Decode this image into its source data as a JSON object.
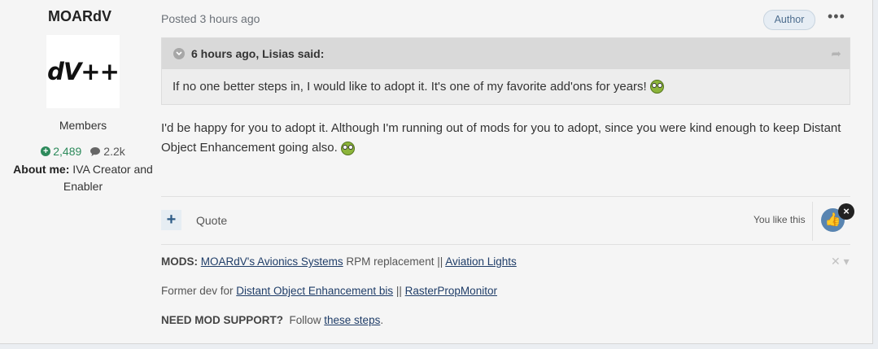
{
  "author": {
    "name": "MOARdV",
    "avatar_text": "dV++",
    "group": "Members",
    "reputation": "2,489",
    "posts": "2.2k",
    "about_label": "About me:",
    "about_value": "IVA Creator and Enabler"
  },
  "post": {
    "posted": "Posted 3 hours ago",
    "badge": "Author",
    "more": "•••",
    "quote_header": "6 hours ago, Lisias said:",
    "quote_text": "If no one better steps in, I would like to adopt it. It's one of my favorite add'ons for years!",
    "content": "I'd be happy for you to adopt it.  Although I'm running out of mods for you to adopt, since you were kind enough to keep Distant Object Enhancement going also."
  },
  "actions": {
    "plus": "+",
    "quote": "Quote",
    "you_like": "You like this",
    "like_icon": "👍",
    "remove_like": "×"
  },
  "signature": {
    "mods_label": "MODS:",
    "mod1": "MOARdV's Avionics Systems",
    "mod1_after": " RPM replacement || ",
    "mod2": "Aviation Lights",
    "former_prefix": "Former dev for ",
    "former1": "Distant Object Enhancement bis",
    "former_sep": " || ",
    "former2": "RasterPropMonitor",
    "support_label": "NEED MOD SUPPORT?",
    "support_prefix": "  Follow ",
    "support_link": "these steps",
    "support_suffix": ".",
    "toggle": "✕ ▾"
  }
}
